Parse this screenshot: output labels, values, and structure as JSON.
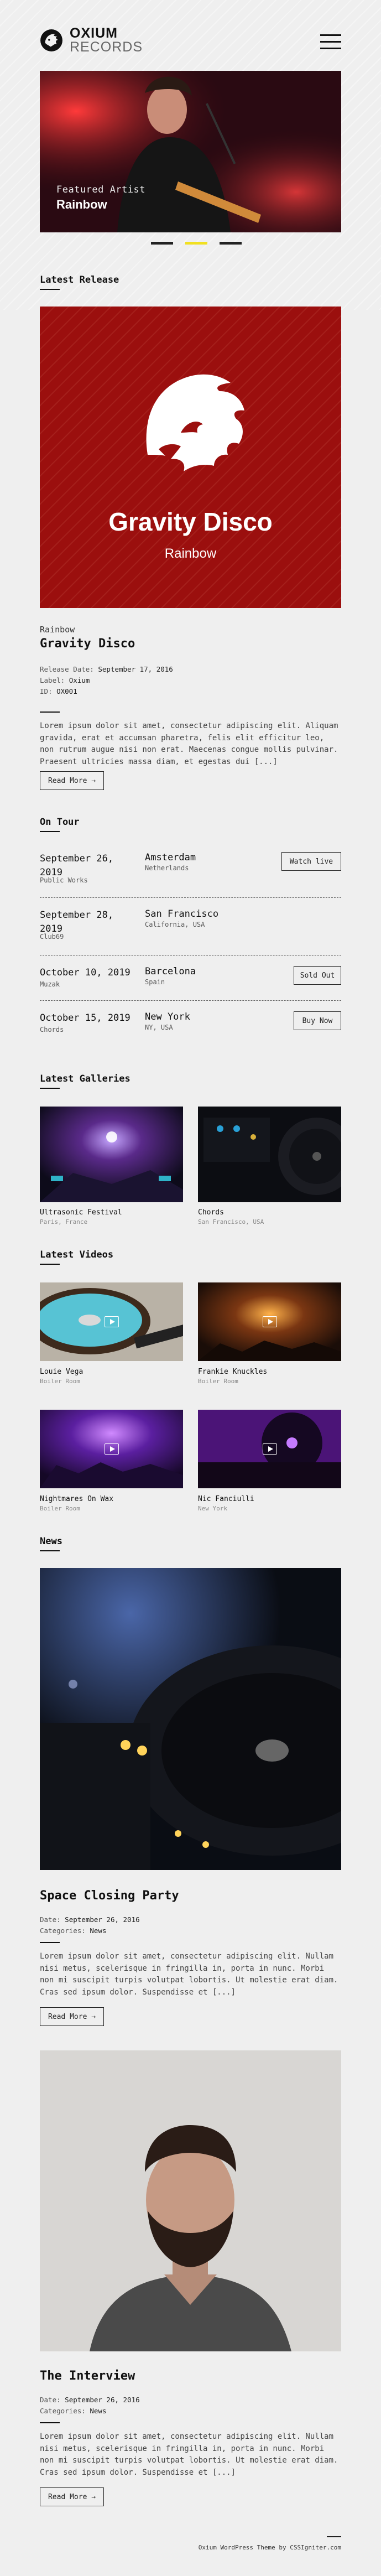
{
  "brand": {
    "line1": "OXIUM",
    "line2": "RECORDS"
  },
  "hero": {
    "caption_small": "Featured Artist",
    "caption_big": "Rainbow"
  },
  "sections": {
    "latest_release": "Latest Release",
    "on_tour": "On Tour",
    "latest_galleries": "Latest Galleries",
    "latest_videos": "Latest Videos",
    "news": "News"
  },
  "release": {
    "cover_title": "Gravity Disco",
    "cover_artist": "Rainbow",
    "artist": "Rainbow",
    "title": "Gravity Disco",
    "date_label": "Release Date:",
    "date_value": "September 17, 2016",
    "label_label": "Label:",
    "label_value": "Oxium",
    "id_label": "ID:",
    "id_value": "OX001",
    "description": "Lorem ipsum dolor sit amet, consectetur adipiscing elit. Aliquam gravida, erat et accumsan pharetra, felis elit efficitur leo, non rutrum augue nisi non erat. Maecenas congue mollis pulvinar. Praesent ultricies massa diam, et egestas dui [...]",
    "read_more": "Read More →"
  },
  "tours": [
    {
      "date": "September 26, 2019",
      "venue": "Public Works",
      "city": "Amsterdam",
      "country": "Netherlands",
      "action": "Watch live"
    },
    {
      "date": "September 28, 2019",
      "venue": "Club69",
      "city": "San Francisco",
      "country": "California, USA",
      "action": ""
    },
    {
      "date": "October 10, 2019",
      "venue": "Muzak",
      "city": "Barcelona",
      "country": "Spain",
      "action": "Sold Out"
    },
    {
      "date": "October 15, 2019",
      "venue": "Chords",
      "city": "New York",
      "country": "NY, USA",
      "action": "Buy Now"
    }
  ],
  "galleries": [
    {
      "title": "Ultrasonic Festival",
      "sub": "Paris, France"
    },
    {
      "title": "Chords",
      "sub": "San Francisco, USA"
    }
  ],
  "videos": [
    {
      "title": "Louie Vega",
      "sub": "Boiler Room"
    },
    {
      "title": "Frankie Knuckles",
      "sub": "Boiler Room"
    },
    {
      "title": "Nightmares On Wax",
      "sub": "Boiler Room"
    },
    {
      "title": "Nic Fanciulli",
      "sub": "New York"
    }
  ],
  "news": [
    {
      "title": "Space Closing Party",
      "date_label": "Date:",
      "date_value": "September 26, 2016",
      "cat_label": "Categories:",
      "cat_value": "News",
      "excerpt": "Lorem ipsum dolor sit amet, consectetur adipiscing elit. Nullam nisi metus, scelerisque in fringilla in, porta in nunc. Morbi non mi suscipit turpis volutpat lobortis. Ut molestie erat diam. Cras sed ipsum dolor. Suspendisse et [...]",
      "read_more": "Read More →"
    },
    {
      "title": "The Interview",
      "date_label": "Date:",
      "date_value": "September 26, 2016",
      "cat_label": "Categories:",
      "cat_value": "News",
      "excerpt": "Lorem ipsum dolor sit amet, consectetur adipiscing elit. Nullam nisi metus, scelerisque in fringilla in, porta in nunc. Morbi non mi suscipit turpis volutpat lobortis. Ut molestie erat diam. Cras sed ipsum dolor. Suspendisse et [...]",
      "read_more": "Read More →"
    }
  ],
  "footer": {
    "credit": "Oxium WordPress Theme by CSSIgniter.com"
  },
  "colors": {
    "accent": "#f1e021",
    "release_cover": "#9b0f0e",
    "background": "#efefef",
    "text": "#111111"
  }
}
